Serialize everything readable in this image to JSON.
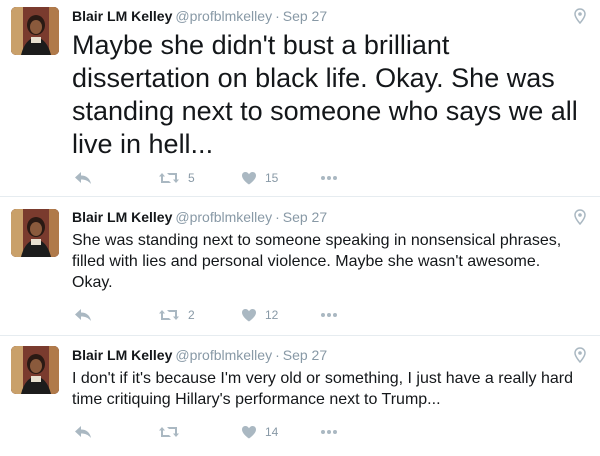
{
  "tweets": [
    {
      "name": "Blair LM Kelley",
      "handle": "@profblmkelley",
      "separator": "·",
      "time": "Sep 27",
      "text": "Maybe she didn't bust a brilliant dissertation on black life. Okay. She was standing next to someone who says we all live in hell...",
      "retweets": "5",
      "likes": "15",
      "icons": [
        "reply-icon",
        "retweet-icon",
        "like-icon",
        "more-icon",
        "location-pin-icon"
      ]
    },
    {
      "name": "Blair LM Kelley",
      "handle": "@profblmkelley",
      "separator": "·",
      "time": "Sep 27",
      "text": "She was standing next to someone speaking in nonsensical phrases, filled with lies and personal violence. Maybe she wasn't awesome. Okay.",
      "retweets": "2",
      "likes": "12",
      "icons": [
        "reply-icon",
        "retweet-icon",
        "like-icon",
        "more-icon",
        "location-pin-icon"
      ]
    },
    {
      "name": "Blair LM Kelley",
      "handle": "@profblmkelley",
      "separator": "·",
      "time": "Sep 27",
      "text": "I don't if it's because I'm very old or something, I just have a really hard time critiquing Hillary's performance next to Trump...",
      "retweets": "",
      "likes": "14",
      "icons": [
        "reply-icon",
        "retweet-icon",
        "like-icon",
        "more-icon",
        "location-pin-icon"
      ]
    }
  ],
  "colors": {
    "text": "#14171a",
    "muted": "#8899a6",
    "icon": "#aab8c2",
    "border": "#e6ecf0"
  }
}
